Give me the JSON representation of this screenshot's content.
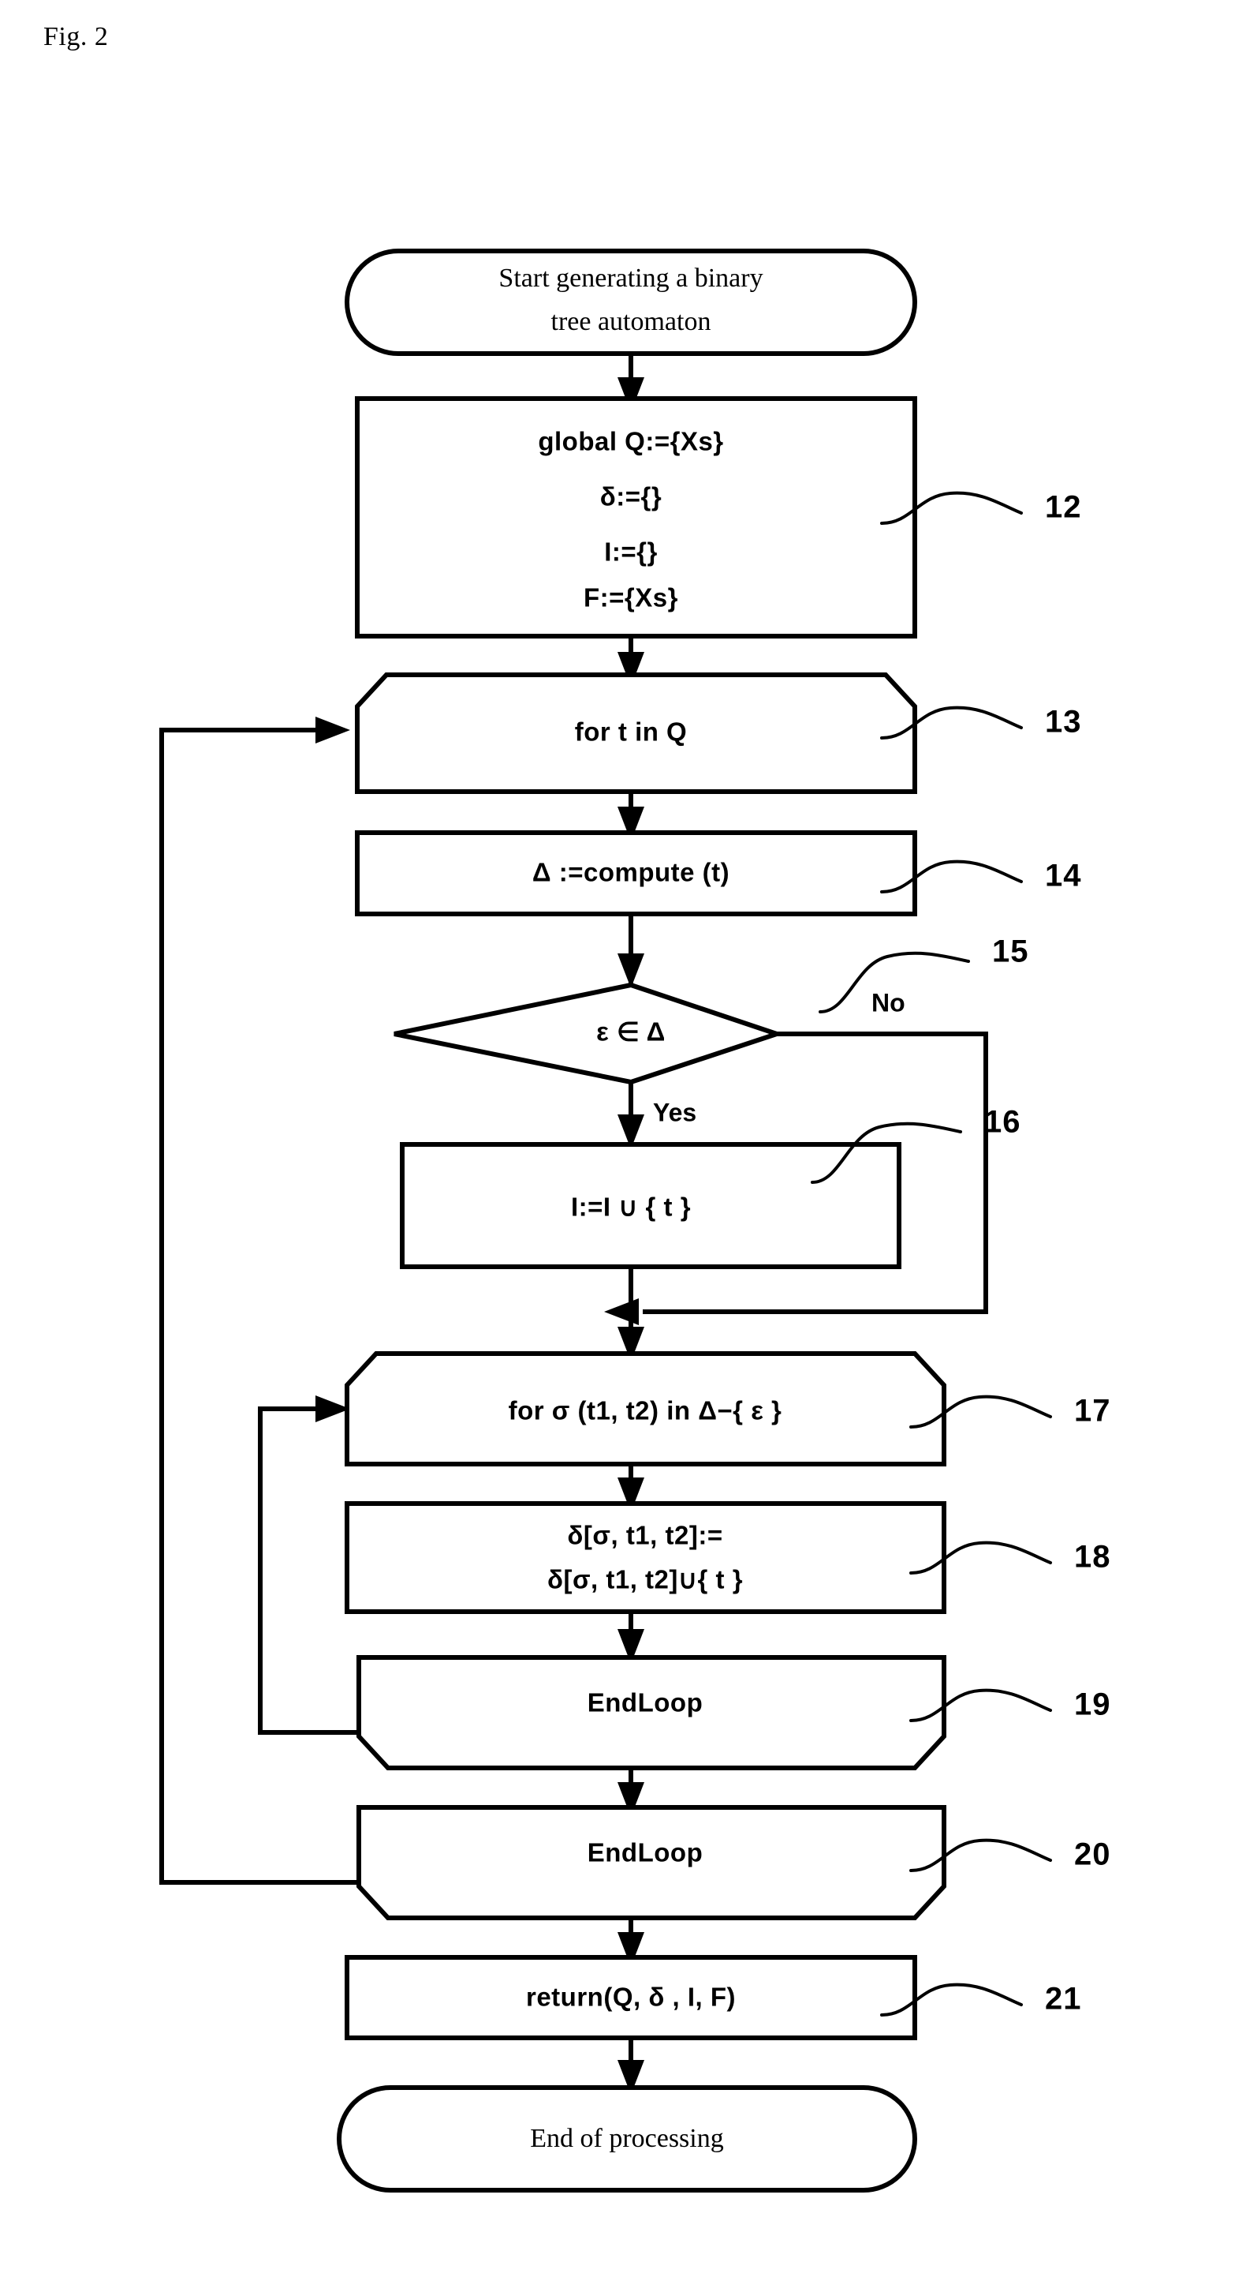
{
  "figure": {
    "label": "Fig. 2",
    "title_note": "Flowchart for generating a binary tree automaton"
  },
  "colors": {
    "stroke": "#000000",
    "fill": "#ffffff",
    "text": "#000000"
  },
  "nodes": [
    {
      "id": "start",
      "shape": "terminator",
      "ref": "",
      "lines": [
        "Start generating a binary",
        "tree automaton"
      ],
      "font": "serif"
    },
    {
      "id": "init",
      "shape": "process",
      "ref": "12",
      "lines": [
        "global Q:={Xs}",
        "δ:={}",
        "I:={}",
        "F:={Xs}"
      ],
      "font": "sans"
    },
    {
      "id": "loop-start-outer",
      "shape": "loop-start",
      "ref": "13",
      "lines": [
        "for t in Q"
      ],
      "font": "sans"
    },
    {
      "id": "compute",
      "shape": "process",
      "ref": "14",
      "lines": [
        "Δ :=compute (t)"
      ],
      "font": "sans"
    },
    {
      "id": "decision-epsilon",
      "shape": "decision",
      "ref": "15",
      "lines": [
        "ε ∈ Δ"
      ],
      "font": "sans"
    },
    {
      "id": "add-initial",
      "shape": "process",
      "ref": "16",
      "lines": [
        "I:=I ∪ { t }"
      ],
      "font": "sans"
    },
    {
      "id": "loop-start-inner",
      "shape": "loop-start",
      "ref": "17",
      "lines": [
        "for σ (t1, t2) in Δ−{ ε }"
      ],
      "font": "sans"
    },
    {
      "id": "update-delta",
      "shape": "process",
      "ref": "18",
      "lines": [
        "δ[σ, t1, t2]:=",
        "δ[σ, t1, t2]∪{ t }"
      ],
      "font": "sans"
    },
    {
      "id": "loop-end-inner",
      "shape": "loop-end",
      "ref": "19",
      "lines": [
        "EndLoop"
      ],
      "font": "sans"
    },
    {
      "id": "loop-end-outer",
      "shape": "loop-end",
      "ref": "20",
      "lines": [
        "EndLoop"
      ],
      "font": "sans"
    },
    {
      "id": "return",
      "shape": "process",
      "ref": "21",
      "lines": [
        "return(Q, δ , I, F)"
      ],
      "font": "sans"
    },
    {
      "id": "end",
      "shape": "terminator",
      "ref": "",
      "lines": [
        "End of processing"
      ],
      "font": "serif"
    }
  ],
  "branch_labels": {
    "no": "No",
    "yes": "Yes"
  },
  "reference_numbers": [
    "12",
    "13",
    "14",
    "15",
    "16",
    "17",
    "18",
    "19",
    "20",
    "21"
  ]
}
